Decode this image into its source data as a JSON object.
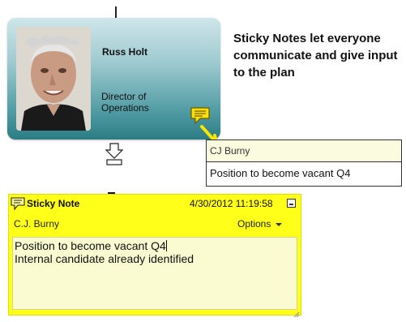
{
  "org_card": {
    "name": "Russ Holt",
    "title": "Director of Operations",
    "photo_icon": "person-photo",
    "comment_icon": "comment-icon"
  },
  "callout": {
    "text": "Sticky Notes let everyone communicate and give input to the plan"
  },
  "tooltip": {
    "author": "CJ Burny",
    "text": "Position to become vacant Q4"
  },
  "sticky_note": {
    "title": "Sticky Note",
    "timestamp": "4/30/2012 11:19:58",
    "author": "C.J. Burny",
    "options_label": "Options",
    "line1": "Position to become vacant Q4",
    "line2": "Internal candidate already identified"
  },
  "colors": {
    "card_teal": "#2b7c84",
    "sticky_yellow": "#ffff1a",
    "tooltip_bg": "#fbfbdf"
  }
}
